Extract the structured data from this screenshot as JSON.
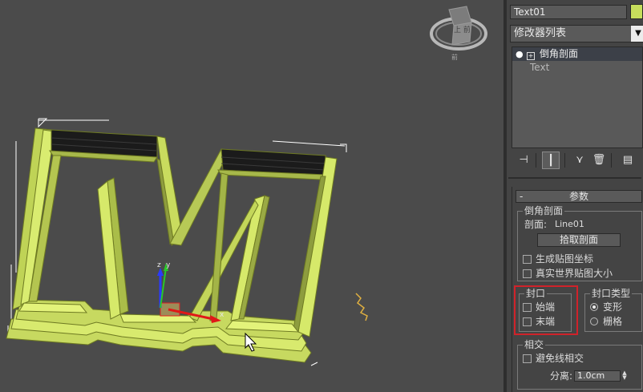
{
  "viewcube": {
    "face_label": "上\n前"
  },
  "gizmo": {
    "y_label": "y",
    "x_label": "x"
  },
  "panel": {
    "object_name": "Text01",
    "object_color": "#c7de5c",
    "modifier_list": {
      "label": "修改器列表",
      "arrow": "▼"
    },
    "stack": [
      {
        "label": "倒角剖面",
        "selected": true,
        "bulb": "💡",
        "plus": "+"
      },
      {
        "label": "Text",
        "selected": false
      }
    ],
    "toolbar": [
      {
        "name": "pin-stack-icon",
        "glyph": "⊣"
      },
      {
        "name": "show-end-result-icon",
        "glyph": "┃"
      },
      {
        "name": "make-unique-icon",
        "glyph": "⋎"
      },
      {
        "name": "remove-modifier-icon",
        "glyph": "🗑"
      },
      {
        "name": "configure-sets-icon",
        "glyph": "▤"
      }
    ],
    "rollout": {
      "minus": "-",
      "title": "参数",
      "bevel_profile": {
        "title": "倒角剖面",
        "profile_label": "剖面:",
        "profile_value": "Line01",
        "pick_button": "拾取剖面",
        "gen_map_coords": "生成贴图坐标",
        "real_world_map": "真实世界贴图大小"
      },
      "capping": {
        "title": "封口",
        "start": "始端",
        "end": "末端"
      },
      "cap_type": {
        "title": "封口类型",
        "morph": "变形",
        "grid": "栅格"
      },
      "intersections": {
        "title": "相交",
        "avoid": "避免线相交",
        "sep_label": "分离:",
        "sep_value": "1.0cm"
      }
    }
  }
}
